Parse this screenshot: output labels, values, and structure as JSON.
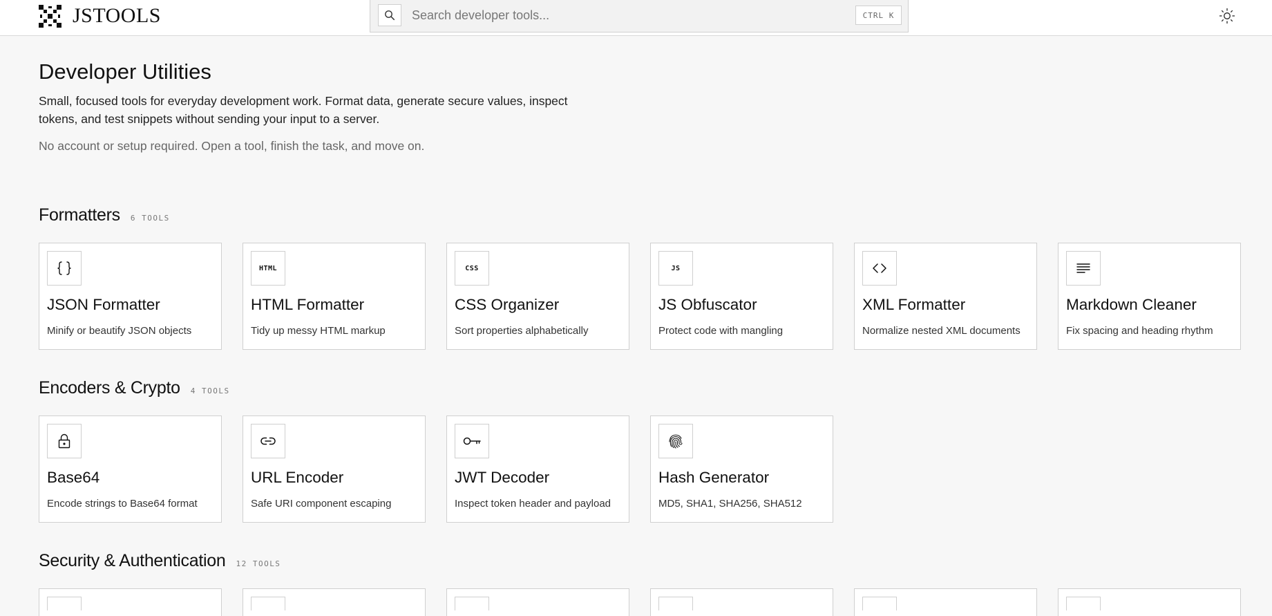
{
  "app": {
    "name": "JSTOOLS"
  },
  "search": {
    "placeholder": "Search developer tools...",
    "shortcut": "CTRL K"
  },
  "hero": {
    "title": "Developer Utilities",
    "description": "Small, focused tools for everyday development work. Format data, generate secure values, inspect tokens, and test snippets without sending your input to a server.",
    "note": "No account or setup required. Open a tool, finish the task, and move on."
  },
  "sections": [
    {
      "title": "Formatters",
      "count": "6 TOOLS",
      "tools": [
        {
          "icon": "braces-icon",
          "icon_text": "",
          "name": "JSON Formatter",
          "desc": "Minify or beautify JSON objects"
        },
        {
          "icon": "html-icon",
          "icon_text": "HTML",
          "name": "HTML Formatter",
          "desc": "Tidy up messy HTML markup"
        },
        {
          "icon": "css-icon",
          "icon_text": "CSS",
          "name": "CSS Organizer",
          "desc": "Sort properties alphabetically"
        },
        {
          "icon": "js-icon",
          "icon_text": "JS",
          "name": "JS Obfuscator",
          "desc": "Protect code with mangling"
        },
        {
          "icon": "code-brackets-icon",
          "icon_text": "",
          "name": "XML Formatter",
          "desc": "Normalize nested XML documents"
        },
        {
          "icon": "text-lines-icon",
          "icon_text": "",
          "name": "Markdown Cleaner",
          "desc": "Fix spacing and heading rhythm"
        }
      ]
    },
    {
      "title": "Encoders & Crypto",
      "count": "4 TOOLS",
      "tools": [
        {
          "icon": "lock-icon",
          "icon_text": "",
          "name": "Base64",
          "desc": "Encode strings to Base64 format"
        },
        {
          "icon": "link-icon",
          "icon_text": "",
          "name": "URL Encoder",
          "desc": "Safe URI component escaping"
        },
        {
          "icon": "key-icon",
          "icon_text": "",
          "name": "JWT Decoder",
          "desc": "Inspect token header and payload"
        },
        {
          "icon": "fingerprint-icon",
          "icon_text": "",
          "name": "Hash Generator",
          "desc": "MD5, SHA1, SHA256, SHA512"
        }
      ]
    },
    {
      "title": "Security & Authentication",
      "count": "12 TOOLS"
    }
  ]
}
